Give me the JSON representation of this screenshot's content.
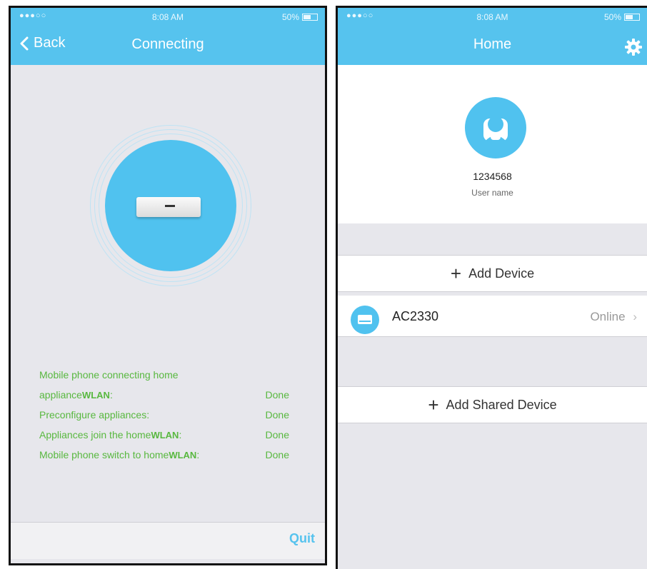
{
  "left": {
    "status": {
      "signal": "●●●○○",
      "time": "8:08 AM",
      "battery": "50%"
    },
    "nav": {
      "back_label": "Back",
      "title": "Connecting"
    },
    "steps": [
      {
        "line1": "Mobile phone connecting home",
        "line2_text": "appliance",
        "line2_wlan": "WLAN",
        "line2_suffix": ":",
        "status": "Done"
      },
      {
        "text": "Preconfigure appliances:",
        "status": "Done"
      },
      {
        "text": "Appliances join the home",
        "wlan": "WLAN",
        "suffix": ":",
        "status": "Done"
      },
      {
        "text": "Mobile phone switch to home",
        "wlan": "WLAN",
        "suffix": ":",
        "status": "Done"
      }
    ],
    "quit_label": "Quit",
    "icons": {
      "back": "chevron-left-icon",
      "device": "air-conditioner-icon"
    }
  },
  "right": {
    "status": {
      "signal": "●●●○○",
      "time": "8:08 AM",
      "battery": "50%"
    },
    "nav": {
      "title": "Home"
    },
    "user": {
      "id": "1234568",
      "name": "User name"
    },
    "add_device_label": "Add Device",
    "device": {
      "name": "AC2330",
      "status": "Online"
    },
    "add_shared_label": "Add Shared Device",
    "icons": {
      "settings": "gear-icon",
      "avatar": "user-icon",
      "device": "air-conditioner-icon",
      "add": "plus-icon",
      "arrow": "chevron-right-icon"
    }
  },
  "colors": {
    "accent": "#56c3ee",
    "status_green": "#58b83f",
    "background": "#e7e7ec"
  }
}
